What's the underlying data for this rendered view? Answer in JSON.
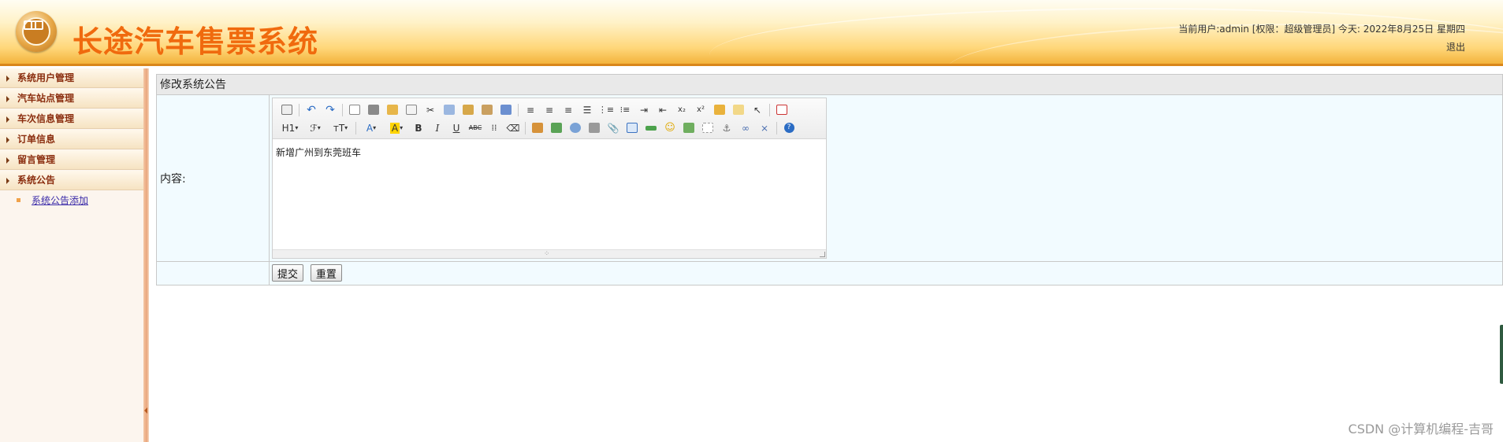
{
  "header": {
    "title": "长途汽车售票系统",
    "user_info": "当前用户:admin [权限：超级管理员] 今天:   2022年8月25日 星期四",
    "logout": "退出"
  },
  "sidebar": {
    "items": [
      {
        "label": "系统用户管理"
      },
      {
        "label": "汽车站点管理"
      },
      {
        "label": "车次信息管理"
      },
      {
        "label": "订单信息"
      },
      {
        "label": "留言管理"
      },
      {
        "label": "系统公告"
      }
    ],
    "sub_items": [
      {
        "label": "系统公告添加"
      }
    ]
  },
  "form": {
    "title": "修改系统公告",
    "content_label": "内容:",
    "content_value": "新增广州到东莞班车",
    "submit": "提交",
    "reset": "重置"
  },
  "editor_toolbar": {
    "heading": "H1",
    "font_family": "ℱ",
    "font_size": "тT"
  },
  "colors": {
    "brand_orange": "#f06a0e",
    "menu_text": "#8a2d0e",
    "form_bg": "#f2fbff"
  },
  "watermark": "CSDN @计算机编程-吉哥"
}
